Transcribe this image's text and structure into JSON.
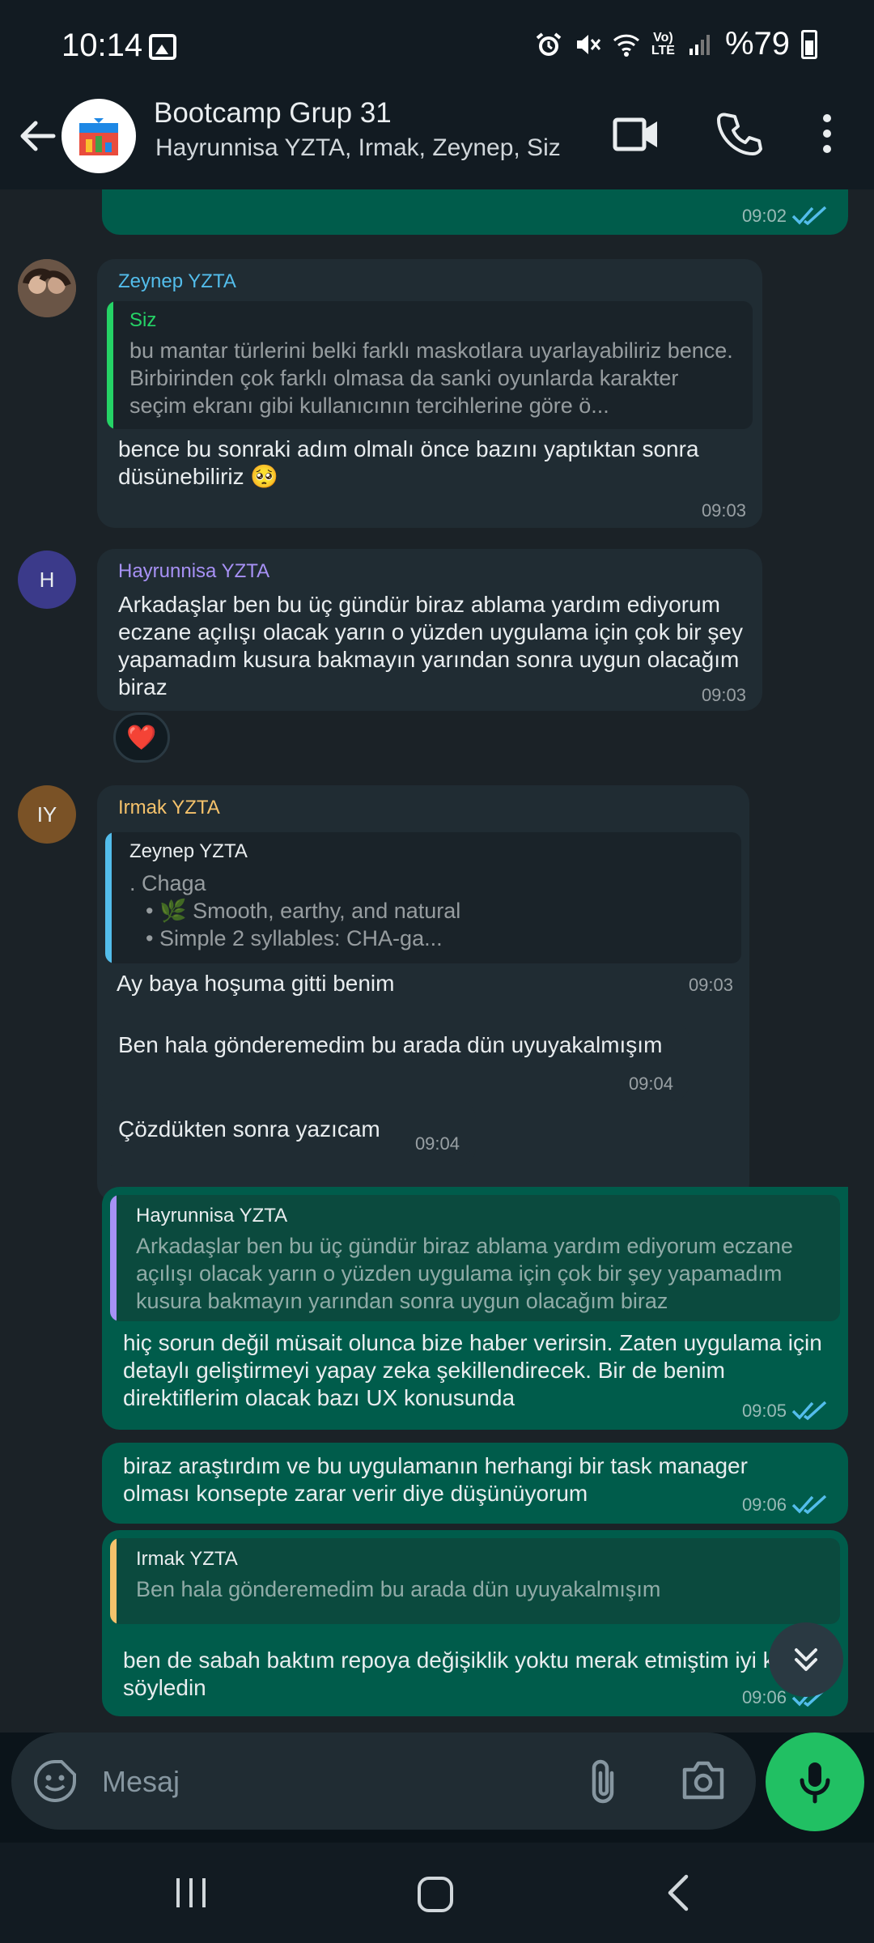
{
  "status_bar": {
    "time": "10:14",
    "battery": "%79",
    "network": "Vo)\nLTE"
  },
  "header": {
    "title": "Bootcamp Grup 31",
    "subtitle": "Hayrunnisa YZTA, Irmak, Zeynep, Siz"
  },
  "messages": {
    "m0": {
      "time": "09:02"
    },
    "m1": {
      "sender": "Zeynep YZTA",
      "quote_name": "Siz",
      "quote_text": "bu mantar türlerini belki farklı maskotlara uyarlayabiliriz bence. Birbirinden çok farklı olmasa da sanki oyunlarda karakter seçim ekranı gibi kullanıcının tercihlerine göre ö...",
      "text": "bence bu sonraki adım olmalı önce bazını yaptıktan sonra düsünebiliriz 🥺",
      "time": "09:03"
    },
    "m2": {
      "sender": "Hayrunnisa YZTA",
      "avatar": "H",
      "text": "Arkadaşlar ben bu üç gündür biraz ablama yardım ediyorum eczane açılışı olacak yarın o yüzden uygulama için çok bir şey yapamadım kusura bakmayın yarından sonra uygun olacağım biraz",
      "time": "09:03",
      "reaction": "❤️"
    },
    "m3": {
      "sender": "Irmak YZTA",
      "avatar": "IY",
      "quote_name": "Zeynep YZTA",
      "quote_line1": ".  Chaga",
      "quote_line2": "• 🌿 Smooth, earthy, and natural",
      "quote_line3": "• Simple 2 syllables: CHA-ga...",
      "text": "Ay baya hoşuma gitti benim",
      "time": "09:03"
    },
    "m4": {
      "text": "Ben hala gönderemedim bu arada dün uyuyakalmışım",
      "time": "09:04"
    },
    "m5": {
      "text": "Çözdükten sonra yazıcam",
      "time": "09:04"
    },
    "m6": {
      "quote_name": "Hayrunnisa YZTA",
      "quote_text": "Arkadaşlar ben bu üç gündür biraz ablama yardım ediyorum eczane açılışı olacak yarın o yüzden uygulama için çok bir şey yapamadım kusura bakmayın yarından sonra uygun olacağım biraz",
      "text": "hiç sorun değil müsait olunca bize haber verirsin. Zaten uygulama için detaylı geliştirmeyi yapay zeka şekillendirecek. Bir de benim direktiflerim olacak bazı UX konusunda",
      "time": "09:05"
    },
    "m7": {
      "text": "biraz araştırdım ve bu uygulamanın herhangi bir task manager olması konsepte zarar verir diye düşünüyorum",
      "time": "09:06"
    },
    "m8": {
      "quote_name": "Irmak YZTA",
      "quote_text": "Ben hala gönderemedim bu arada dün uyuyakalmışım",
      "text": "ben de sabah baktım repoya değişiklik yoktu merak etmiştim iyi ki söyledin",
      "time": "09:06"
    }
  },
  "input": {
    "placeholder": "Mesaj"
  },
  "colors": {
    "sender_zeynep": "#53bdeb",
    "sender_hayrunnisa": "#a791f5",
    "sender_irmak": "#f5c26b",
    "out_bubble": "#005c4b",
    "in_bubble": "#202c33",
    "mic_button": "#21c063",
    "read_ticks": "#53bdeb"
  },
  "icons": [
    "back-arrow-icon",
    "group-avatar-icon",
    "video-call-icon",
    "voice-call-icon",
    "more-options-icon",
    "sticker-icon",
    "attach-icon",
    "camera-icon",
    "mic-icon",
    "scroll-down-icon",
    "recent-apps-icon",
    "home-icon",
    "nav-back-icon",
    "gallery-icon",
    "alarm-icon",
    "mute-icon",
    "wifi-icon",
    "signal-icon",
    "battery-icon"
  ]
}
